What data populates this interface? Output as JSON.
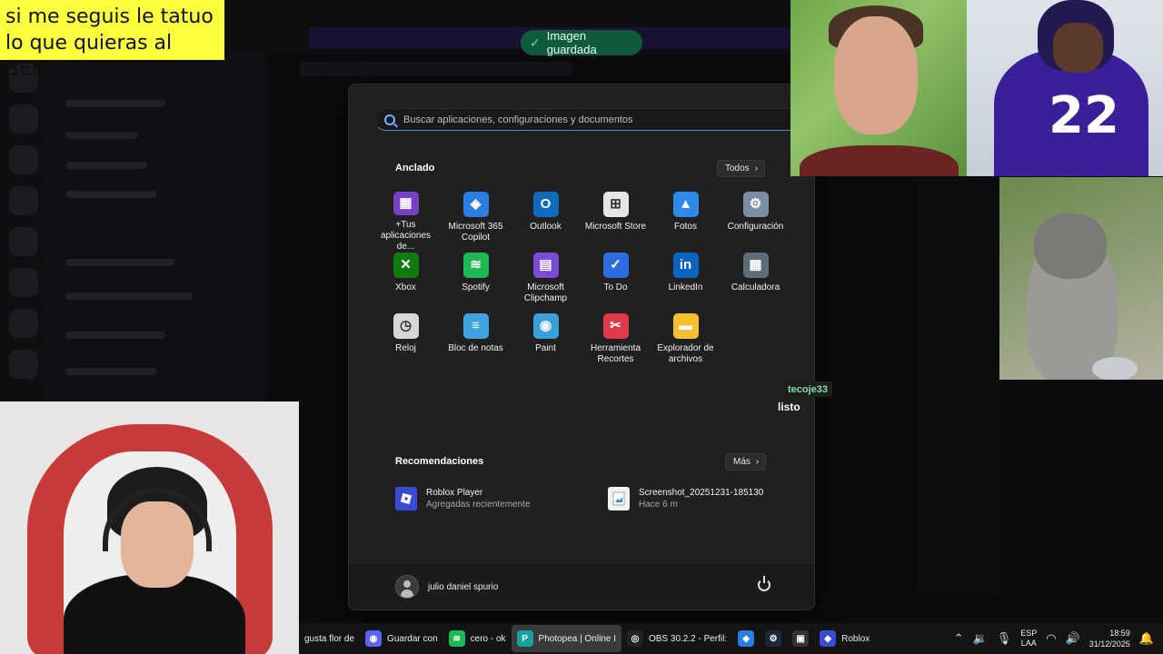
{
  "overlay": {
    "text": "si me seguis le tatuo lo que quieras al BEBE : )"
  },
  "toast": {
    "text": "Imagen guardada"
  },
  "start_menu": {
    "search_placeholder": "Buscar aplicaciones, configuraciones y documentos",
    "pinned_title": "Anclado",
    "all_button": "Todos",
    "apps": [
      {
        "label": "+Tus aplicaciones de...",
        "icon": "app-bundle-icon",
        "color": "#7a3fc9"
      },
      {
        "label": "Microsoft 365 Copilot",
        "icon": "copilot-icon",
        "color": "#2a7de1"
      },
      {
        "label": "Outlook",
        "icon": "outlook-icon",
        "color": "#0f6cbd"
      },
      {
        "label": "Microsoft Store",
        "icon": "store-icon",
        "color": "#e6e6e6"
      },
      {
        "label": "Fotos",
        "icon": "photos-icon",
        "color": "#2c8be8"
      },
      {
        "label": "Configuración",
        "icon": "gear-icon",
        "color": "#7c8ea3"
      },
      {
        "label": "Xbox",
        "icon": "xbox-icon",
        "color": "#107c10"
      },
      {
        "label": "Spotify",
        "icon": "spotify-icon",
        "color": "#1db954"
      },
      {
        "label": "Microsoft Clipchamp",
        "icon": "clipchamp-icon",
        "color": "#7b4bd6"
      },
      {
        "label": "To Do",
        "icon": "todo-icon",
        "color": "#2d6de0"
      },
      {
        "label": "LinkedIn",
        "icon": "linkedin-icon",
        "color": "#0a66c2"
      },
      {
        "label": "Calculadora",
        "icon": "calculator-icon",
        "color": "#5e6b78"
      },
      {
        "label": "Reloj",
        "icon": "clock-icon",
        "color": "#d6d6d6"
      },
      {
        "label": "Bloc de notas",
        "icon": "notepad-icon",
        "color": "#3fa3e0"
      },
      {
        "label": "Paint",
        "icon": "paint-icon",
        "color": "#3aa0d8"
      },
      {
        "label": "Herramienta Recortes",
        "icon": "snipping-tool-icon",
        "color": "#e03a4a"
      },
      {
        "label": "Explorador de archivos",
        "icon": "folder-icon",
        "color": "#f5c02b"
      }
    ],
    "recommended_title": "Recomendaciones",
    "more_button": "Más",
    "recommended": [
      {
        "title": "Roblox Player",
        "subtitle": "Agregadas recientemente",
        "icon": "roblox-icon"
      },
      {
        "title": "Screenshot_20251231-185130",
        "subtitle": "Hace 6 m",
        "icon": "image-file-icon"
      }
    ],
    "user_name": "julio daniel spurio"
  },
  "chat": {
    "user": "tecoje33",
    "message": "listo"
  },
  "taskbar": {
    "items": [
      {
        "label": "gusta flor de",
        "icon": "",
        "color": ""
      },
      {
        "label": "Guardar con",
        "icon": "discord-icon",
        "color": "#5865f2"
      },
      {
        "label": "cero - ok",
        "icon": "spotify-icon",
        "color": "#1db954"
      },
      {
        "label": "Photopea | Online I",
        "icon": "photopea-icon",
        "color": "#17a2a2"
      },
      {
        "label": "OBS 30.2.2 - Perfil:",
        "icon": "obs-icon",
        "color": "#222222"
      },
      {
        "label": "",
        "icon": "copilot-icon",
        "color": "#2a7de1"
      },
      {
        "label": "",
        "icon": "steam-icon",
        "color": "#1b2838"
      },
      {
        "label": "",
        "icon": "app-icon",
        "color": "#333333"
      },
      {
        "label": "Roblox",
        "icon": "roblox-icon",
        "color": "#3a4bd6"
      }
    ],
    "lang_line1": "ESP",
    "lang_line2": "LAA",
    "time": "18:59",
    "date": "31/12/2025"
  }
}
